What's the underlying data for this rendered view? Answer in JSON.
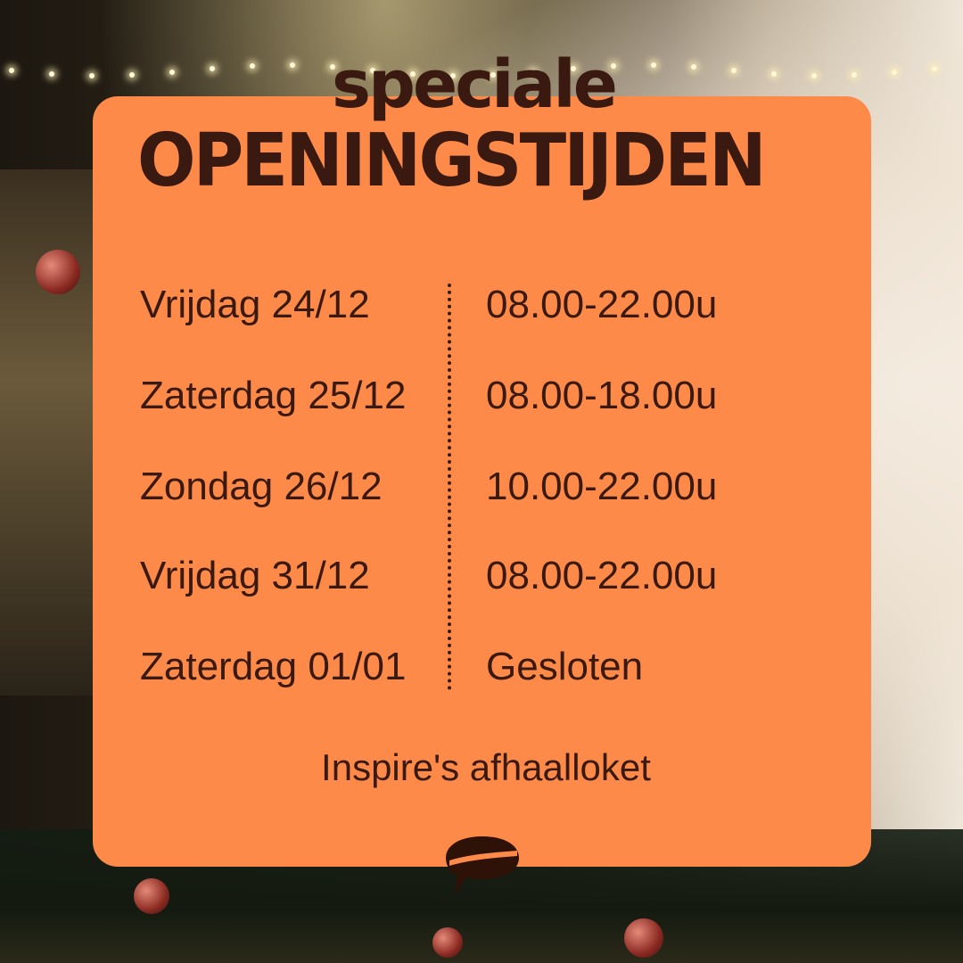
{
  "header": {
    "title_small": "speciale",
    "title_large": "OPENINGSTIJDEN"
  },
  "schedule": [
    {
      "day": "Vrijdag 24/12",
      "hours": "08.00-22.00u"
    },
    {
      "day": "Zaterdag 25/12",
      "hours": "08.00-18.00u"
    },
    {
      "day": "Zondag 26/12",
      "hours": "10.00-22.00u"
    },
    {
      "day": "Vrijdag 31/12",
      "hours": "08.00-22.00u"
    },
    {
      "day": "Zaterdag 01/01",
      "hours": "Gesloten"
    }
  ],
  "footer": {
    "location": "Inspire's afhaalloket",
    "logo_icon": "speech-bubble-logo-icon"
  },
  "colors": {
    "card": "#fe8a49",
    "text": "#3a1a10"
  }
}
